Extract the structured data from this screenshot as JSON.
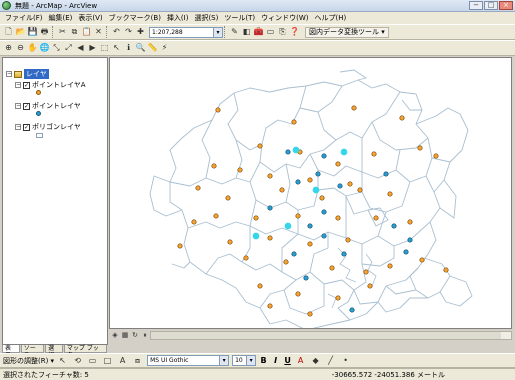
{
  "window": {
    "title": "無題 - ArcMap - ArcView",
    "minimize": "−",
    "maximize": "□",
    "close": "×"
  },
  "menu": [
    "ファイル(F)",
    "編集(E)",
    "表示(V)",
    "ブックマーク(B)",
    "挿入(I)",
    "選択(S)",
    "ツール(T)",
    "ウィンドウ(W)",
    "ヘルプ(H)"
  ],
  "toolbar": {
    "scale_value": "1:207,288",
    "transform_tool": "図内データ変換ツール ▾"
  },
  "toc": {
    "root_label": "レイヤ",
    "layers": [
      {
        "name": "ポイントレイヤA",
        "symbol_color": "#f5a331",
        "checked": true
      },
      {
        "name": "ポイントレイヤ",
        "symbol_color": "#2a9ed0",
        "checked": true
      },
      {
        "name": "ポリゴンレイヤ",
        "symbol": "polygon",
        "checked": true
      }
    ],
    "tabs": [
      "表示",
      "ソース",
      "選択",
      "マップ ブック"
    ]
  },
  "drawing": {
    "shape_menu": "図形の調整(R) ▾",
    "font": "MS UI Gothic",
    "size": "10",
    "bold": "B",
    "italic": "I",
    "underline": "U"
  },
  "status": {
    "selected": "選択されたフィーチャ数: 5",
    "coordinates": "-30665.572  -24051.386 メートル"
  },
  "colors": {
    "orange_point": "#f5a331",
    "blue_point": "#2a9ed0",
    "cyan_point": "#35d6ea",
    "boundary": "#a9bfd0"
  }
}
